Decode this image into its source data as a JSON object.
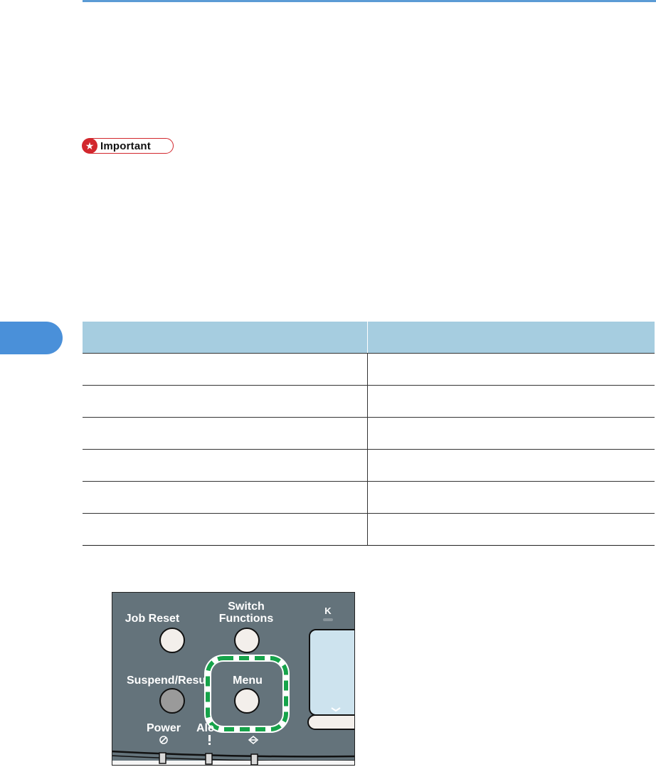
{
  "important": {
    "label": "Important",
    "icon": "star-icon"
  },
  "table": {
    "headers": [
      "",
      ""
    ],
    "rows": [
      [
        "",
        ""
      ],
      [
        "",
        ""
      ],
      [
        "",
        ""
      ],
      [
        "",
        ""
      ],
      [
        "",
        ""
      ],
      [
        "",
        ""
      ]
    ]
  },
  "panel": {
    "buttons": {
      "job_reset": "Job Reset",
      "switch_functions_line1": "Switch",
      "switch_functions_line2": "Functions",
      "suspend_resume": "Suspend/Resum",
      "menu": "Menu"
    },
    "indicators": {
      "power": "Power",
      "alert": "Ale",
      "k": "K"
    },
    "colors": {
      "panel": "#64737b",
      "button": "#f3efeb",
      "suspend_button": "#9a9a9a",
      "highlight": "#16a34a",
      "display": "#cde3ee"
    }
  }
}
